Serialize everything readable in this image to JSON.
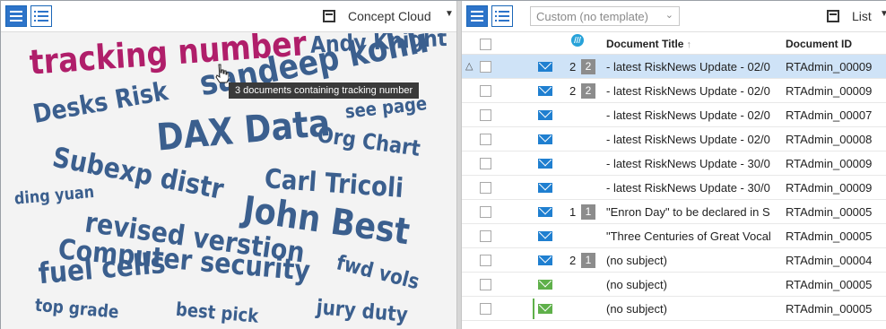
{
  "left_panel": {
    "view_label": "Concept Cloud",
    "tooltip": "3 documents containing tracking number"
  },
  "cloud_words": [
    {
      "text": "tracking number",
      "highlight": true
    },
    {
      "text": "Andy Knight"
    },
    {
      "text": "sandeep kohli"
    },
    {
      "text": "Desks Risk"
    },
    {
      "text": "see page"
    },
    {
      "text": "DAX Data"
    },
    {
      "text": "Org Chart"
    },
    {
      "text": "Subexp distr"
    },
    {
      "text": "Carl Tricoli"
    },
    {
      "text": "ding yuan"
    },
    {
      "text": "John Best"
    },
    {
      "text": "revised verstion"
    },
    {
      "text": "Computer security"
    },
    {
      "text": "fwd vols"
    },
    {
      "text": "fuel cells"
    },
    {
      "text": "jury duty"
    },
    {
      "text": "top grade"
    },
    {
      "text": "best pick"
    }
  ],
  "right_panel": {
    "template_placeholder": "Custom (no template)",
    "view_label": "List",
    "columns": {
      "title": "Document Title",
      "docid": "Document ID"
    },
    "rows": [
      {
        "count": "2",
        "badge": "2",
        "title": "- latest RiskNews Update - 02/0",
        "docid": "RTAdmin_00009",
        "mail": "blue",
        "selected": true,
        "indicator": "△"
      },
      {
        "count": "2",
        "badge": "2",
        "title": "- latest RiskNews Update - 02/0",
        "docid": "RTAdmin_00009",
        "mail": "blue"
      },
      {
        "count": "",
        "badge": "",
        "title": "- latest RiskNews Update - 02/0",
        "docid": "RTAdmin_00007",
        "mail": "blue"
      },
      {
        "count": "",
        "badge": "",
        "title": "- latest RiskNews Update - 02/0",
        "docid": "RTAdmin_00008",
        "mail": "blue"
      },
      {
        "count": "",
        "badge": "",
        "title": "- latest RiskNews Update - 30/0",
        "docid": "RTAdmin_00009",
        "mail": "blue"
      },
      {
        "count": "",
        "badge": "",
        "title": "- latest RiskNews Update - 30/0",
        "docid": "RTAdmin_00009",
        "mail": "blue"
      },
      {
        "count": "1",
        "badge": "1",
        "title": "\"Enron Day\" to be declared in S",
        "docid": "RTAdmin_00005",
        "mail": "blue"
      },
      {
        "count": "",
        "badge": "",
        "title": "\"Three Centuries of Great Vocal",
        "docid": "RTAdmin_00005",
        "mail": "blue"
      },
      {
        "count": "2",
        "badge": "1",
        "title": "(no subject)",
        "docid": "RTAdmin_00004",
        "mail": "blue"
      },
      {
        "count": "",
        "badge": "",
        "title": "(no subject)",
        "docid": "RTAdmin_00005",
        "mail": "green"
      },
      {
        "count": "",
        "badge": "",
        "title": "(no subject)",
        "docid": "RTAdmin_00005",
        "mail": "green",
        "greenbar": true
      }
    ]
  },
  "colors": {
    "accent": "#2d74c9",
    "cloud_word": "#3b5f8e",
    "cloud_highlight": "#b01e6a",
    "selected_row": "#cfe3f7",
    "mail_blue": "#1f7fd0",
    "mail_green": "#5fb04a",
    "badge": "#8c8c8c"
  }
}
